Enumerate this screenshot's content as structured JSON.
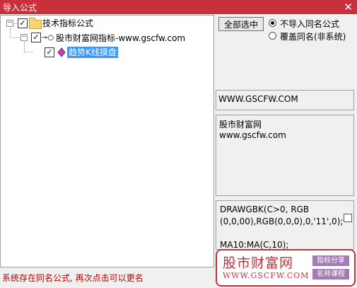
{
  "window": {
    "title": "导入公式",
    "close_glyph": "✕"
  },
  "tree": {
    "root": {
      "label": "技术指标公式",
      "expander": "−",
      "check": "✓"
    },
    "child": {
      "label": "股市财富网指标-www.gscfw.com",
      "expander": "−",
      "check": "✓",
      "icon_glyph": "⊸○"
    },
    "leaf": {
      "label": "趋势K线摸盘",
      "check": "✓"
    }
  },
  "buttons": {
    "select_all": "全部选中"
  },
  "options": {
    "skip_same": "不导入同名公式",
    "overwrite_same": "覆盖同名(非系统)",
    "selected": "skip_same"
  },
  "info": {
    "website": "WWW.GSCFW.COM",
    "description_line1": "股市财富网",
    "description_line2": "www.gscfw.com",
    "code_line1": "DRAWGBK(C>0, RGB",
    "code_line2": "(0,0,00),RGB(0,0,0),0,'11',0);",
    "code_line3": "MA10:MA(C,10);"
  },
  "status": {
    "message": "系统存在同名公式, 再次点击可以更名"
  },
  "watermark": {
    "brand_cn": "股市财富网",
    "brand_url": "WWW.GSCFW.COM",
    "tag1": "指标分享",
    "tag2": "名师课程",
    "color": "#c8313c",
    "tag_color": "#a47ab5"
  }
}
